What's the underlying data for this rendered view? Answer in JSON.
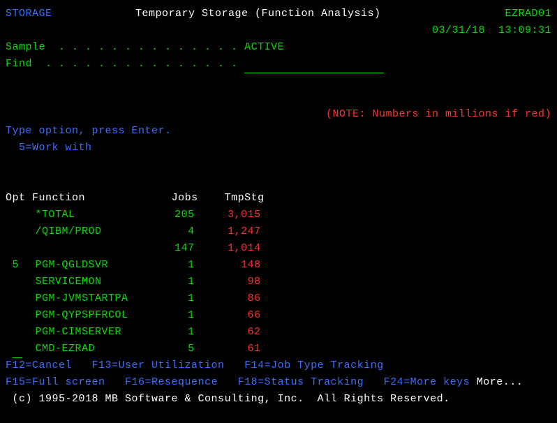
{
  "header": {
    "left": "STORAGE",
    "center": "Temporary Storage (Function Analysis)",
    "right": "EZRAD01",
    "date": "03/31/18",
    "time": "13:09:31"
  },
  "sample": {
    "label": "Sample  . . . . . . . . . . . . . .",
    "value": "ACTIVE"
  },
  "find": {
    "label": "Find  . . . . . . . . . . . . . . ."
  },
  "note": "(NOTE: Numbers in millions if red)",
  "instructions": "Type option, press Enter.",
  "option_help": "5=Work with",
  "columns": {
    "opt": "Opt",
    "function": "Function",
    "jobs": "Jobs",
    "tmpstg": "TmpStg"
  },
  "rows": [
    {
      "opt": "",
      "function": "*TOTAL",
      "jobs": "205",
      "tmpstg": "3,015"
    },
    {
      "opt": "",
      "function": "/QIBM/PROD",
      "jobs": "4",
      "tmpstg": "1,247"
    },
    {
      "opt": "",
      "function": "",
      "jobs": "147",
      "tmpstg": "1,014"
    },
    {
      "opt": "5",
      "function": "PGM-QGLDSVR",
      "jobs": "1",
      "tmpstg": "148"
    },
    {
      "opt": "",
      "function": "SERVICEMON",
      "jobs": "1",
      "tmpstg": "98"
    },
    {
      "opt": "",
      "function": "PGM-JVMSTARTPA",
      "jobs": "1",
      "tmpstg": "86"
    },
    {
      "opt": "",
      "function": "PGM-QYPSPFRCOL",
      "jobs": "1",
      "tmpstg": "66"
    },
    {
      "opt": "",
      "function": "PGM-CIMSERVER",
      "jobs": "1",
      "tmpstg": "62"
    },
    {
      "opt": "",
      "function": "CMD-EZRAD",
      "jobs": "5",
      "tmpstg": "61"
    }
  ],
  "fkeys1": {
    "f12": "F12=Cancel",
    "f13": "F13=User Utilization",
    "f14": "F14=Job Type Tracking"
  },
  "fkeys2": {
    "f15": "F15=Full screen",
    "f16": "F16=Resequence",
    "f18": "F18=Status Tracking",
    "f24": "F24=More keys",
    "more": "More..."
  },
  "copyright": "(c) 1995-2018 MB Software & Consulting, Inc.  All Rights Reserved."
}
